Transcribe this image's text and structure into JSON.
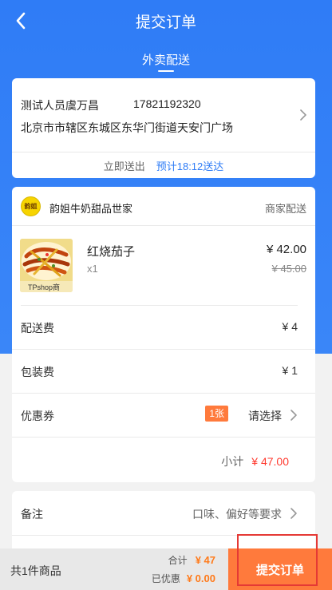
{
  "header": {
    "title": "提交订单"
  },
  "delivery_mode": "外卖配送",
  "address": {
    "name": "测试人员虞万昌",
    "phone": "17821192320",
    "detail": "北京市市辖区东城区东华门街道天安门广场",
    "delivery_now": "立即送出",
    "eta": "预计18:12送达"
  },
  "shop": {
    "name": "韵姐牛奶甜品世家",
    "logo_text": "韵姐",
    "delivery_type": "商家配送"
  },
  "product": {
    "name": "红烧茄子",
    "qty": "x1",
    "price": "¥ 42.00",
    "original_price": "¥ 45.00",
    "image_watermark": "TPshop商"
  },
  "fees": {
    "delivery_label": "配送费",
    "delivery_value": "¥ 4",
    "packing_label": "包装费",
    "packing_value": "¥ 1"
  },
  "coupon": {
    "label": "优惠券",
    "badge": "1张",
    "action": "请选择"
  },
  "subtotal": {
    "label": "小计",
    "value": "¥ 47.00"
  },
  "notes": {
    "label": "备注",
    "placeholder": "口味、偏好等要求"
  },
  "bottom": {
    "item_count": "共1件商品",
    "total_label": "合计",
    "total_value": "¥ 47",
    "discount_label": "已优惠",
    "discount_value": "¥ 0.00",
    "submit_label": "提交订单"
  },
  "colors": {
    "primary_blue": "#2f7cf6",
    "accent_orange": "#ff7a3c",
    "price_red": "#ff3b30",
    "highlight_red": "#e53935"
  }
}
